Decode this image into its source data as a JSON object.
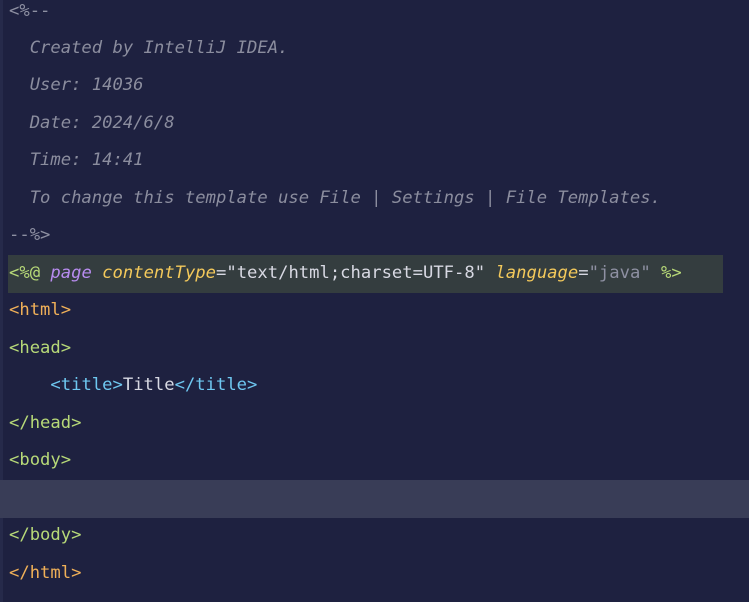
{
  "comment": {
    "open": "<%--",
    "created_by": "  Created by IntelliJ IDEA.",
    "user": "  User: 14036",
    "date": "  Date: 2024/6/8",
    "time": "  Time: 14:41",
    "hint": "  To change this template use File | Settings | File Templates.",
    "close": "--%>"
  },
  "directive": {
    "open": "<%@",
    "keyword": "page",
    "attr1_name": "contentType",
    "attr1_value": "\"text/html;charset=UTF-8\"",
    "attr2_name": "language",
    "attr2_value": "\"java\"",
    "close": "%>"
  },
  "html_open": {
    "lt": "<",
    "name": "html",
    "gt": ">"
  },
  "head_open": {
    "text": "<head>"
  },
  "title_line": {
    "indent": "    ",
    "open_tag": "<title>",
    "text": "Title",
    "close_tag": "</title>"
  },
  "head_close": {
    "text": "</head>"
  },
  "body_open": {
    "text": "<body>"
  },
  "body_close": {
    "text": "</body>"
  },
  "html_close": {
    "lt": "</",
    "name": "html",
    "gt": ">"
  },
  "colors": {
    "background": "#1e2140",
    "caret_line": "#393d57",
    "directive_highlight": "#343d3f",
    "comment": "#8b8d9e",
    "orange_tag": "#f0b058",
    "green_tag": "#b7d978",
    "blue_tag": "#6ec7f0",
    "purple_keyword": "#b88cf0",
    "yellow_attribute": "#f3c95b"
  }
}
